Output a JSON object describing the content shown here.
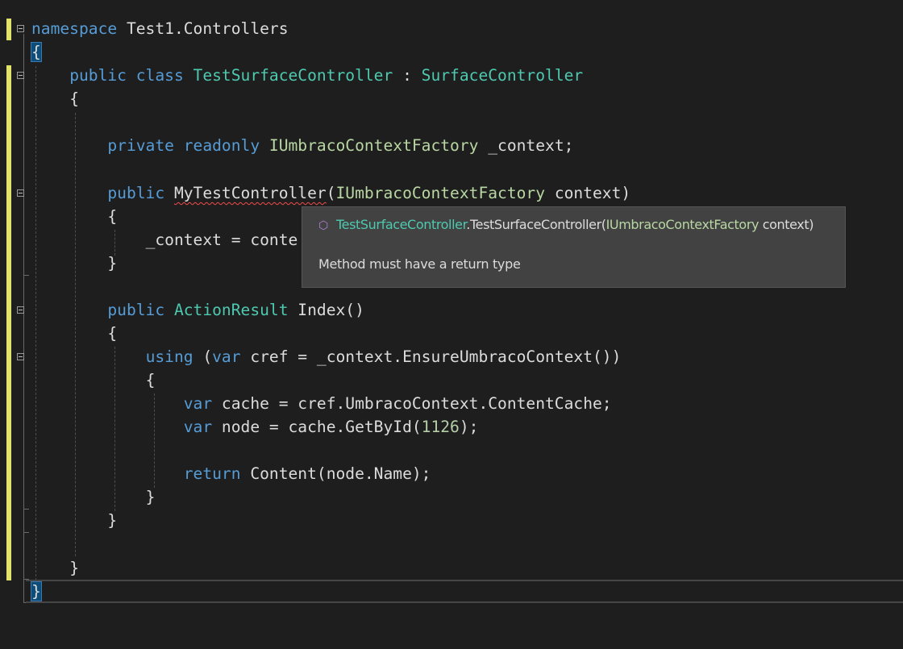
{
  "code": {
    "namespace_kw": "namespace",
    "namespace_name": "Test1.Controllers",
    "open_brace": "{",
    "close_brace": "}",
    "kw_public": "public",
    "kw_class": "class",
    "kw_private": "private",
    "kw_readonly": "readonly",
    "kw_using": "using",
    "kw_var": "var",
    "kw_return": "return",
    "class_name": "TestSurfaceController",
    "colon": " : ",
    "base_class": "SurfaceController",
    "factory_type": "IUmbracoContextFactory",
    "field_name": " _context;",
    "ctor_name": "MyTestController",
    "ctor_params_open": "(",
    "ctor_params_rest": " context)",
    "assign_line": "_context = conte",
    "action_type": "ActionResult",
    "action_sig": " Index()",
    "using_rest": " cref = _context.EnsureUmbracoContext())",
    "open_paren": " (",
    "cache_rest": " cache = cref.UmbracoContext.ContentCache;",
    "node_rest_a": " node = cache.GetById(",
    "node_number": "1126",
    "node_rest_b": ");",
    "return_rest": " Content(node.Name);"
  },
  "tooltip": {
    "icon": "cube-icon",
    "sig_class": "TestSurfaceController",
    "sig_method": ".TestSurfaceController(",
    "sig_param_type": "IUmbracoContextFactory",
    "sig_param_rest": " context)",
    "message": "Method must have a return type"
  },
  "colors": {
    "keyword": "#569cd6",
    "type": "#4ec9b0",
    "interface": "#b8d7a3",
    "number": "#b5cea8",
    "text": "#dcdcdc",
    "change_marker": "#e2e36b",
    "error_squiggle": "#f14c4c"
  }
}
